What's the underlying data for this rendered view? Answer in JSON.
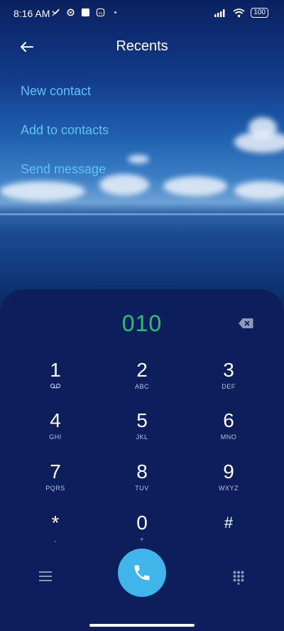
{
  "status_bar": {
    "time": "8:16 AM",
    "battery": "100"
  },
  "header": {
    "title": "Recents"
  },
  "menu": {
    "new_contact": "New contact",
    "add_to_contacts": "Add to contacts",
    "send_message": "Send message"
  },
  "dialer": {
    "number": "010",
    "keys": [
      {
        "digit": "1",
        "letters": ""
      },
      {
        "digit": "2",
        "letters": "ABC"
      },
      {
        "digit": "3",
        "letters": "DEF"
      },
      {
        "digit": "4",
        "letters": "GHI"
      },
      {
        "digit": "5",
        "letters": "JKL"
      },
      {
        "digit": "6",
        "letters": "MNO"
      },
      {
        "digit": "7",
        "letters": "PQRS"
      },
      {
        "digit": "8",
        "letters": "TUV"
      },
      {
        "digit": "9",
        "letters": "WXYZ"
      },
      {
        "digit": "*",
        "letters": ","
      },
      {
        "digit": "0",
        "letters": "+"
      },
      {
        "digit": "#",
        "letters": ""
      }
    ]
  },
  "colors": {
    "accent_link": "#5ec3f2",
    "number_green": "#27c46b",
    "call_button": "#3fb5e9",
    "panel": "#0c1f5c"
  },
  "icons": {
    "back": "arrow-left-icon",
    "backspace": "backspace-icon",
    "voicemail": "voicemail-icon",
    "menu": "hamburger-icon",
    "call": "phone-icon",
    "keypad": "keypad-icon"
  }
}
